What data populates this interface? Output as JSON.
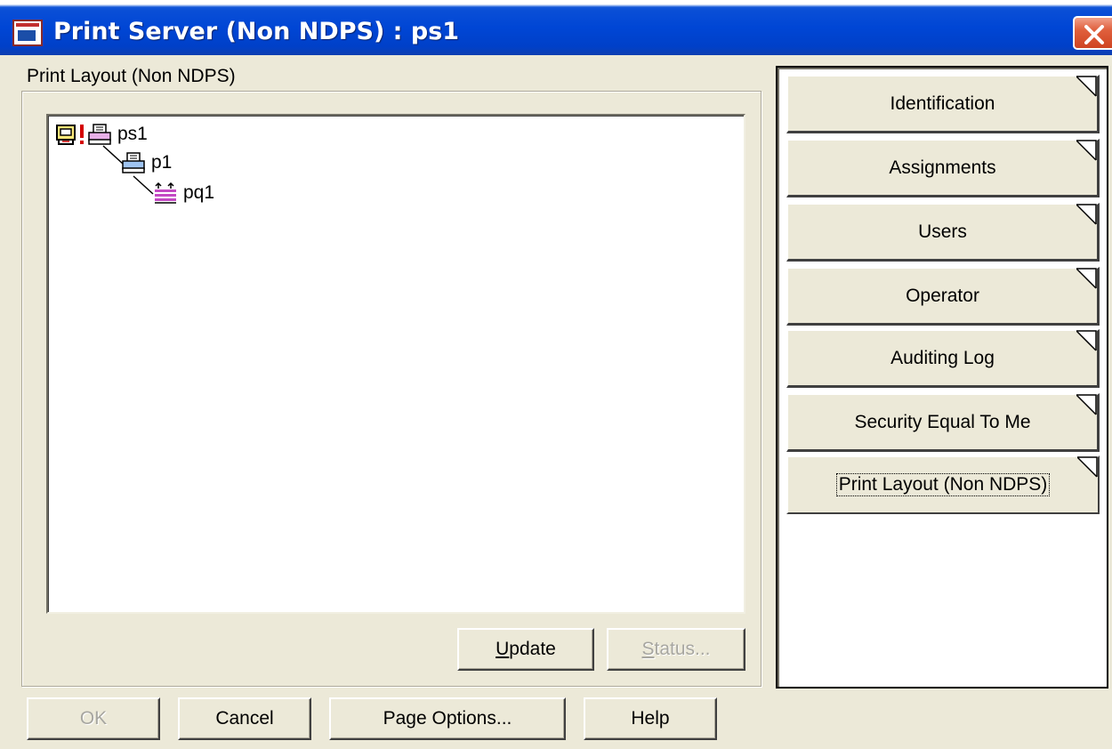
{
  "window": {
    "title": "Print Server (Non NDPS) : ps1"
  },
  "panel": {
    "group_label": "Print Layout (Non NDPS)",
    "tree": [
      {
        "label": "ps1",
        "icon": "print-server-icon",
        "status": "error"
      },
      {
        "label": "p1",
        "icon": "printer-icon"
      },
      {
        "label": "pq1",
        "icon": "print-queue-icon"
      }
    ],
    "update_label": "Update",
    "status_label": "Status..."
  },
  "pages": [
    {
      "label": "Identification"
    },
    {
      "label": "Assignments"
    },
    {
      "label": "Users"
    },
    {
      "label": "Operator"
    },
    {
      "label": "Auditing Log"
    },
    {
      "label": "Security Equal To Me"
    },
    {
      "label": "Print Layout (Non NDPS)",
      "active": true
    }
  ],
  "footer": {
    "ok_label": "OK",
    "cancel_label": "Cancel",
    "page_options_label": "Page Options...",
    "help_label": "Help"
  },
  "colors": {
    "titlebar": "#0046d5",
    "dialog_bg": "#ece9d8",
    "close_button": "#e0603d",
    "error_mark": "#d40000"
  }
}
